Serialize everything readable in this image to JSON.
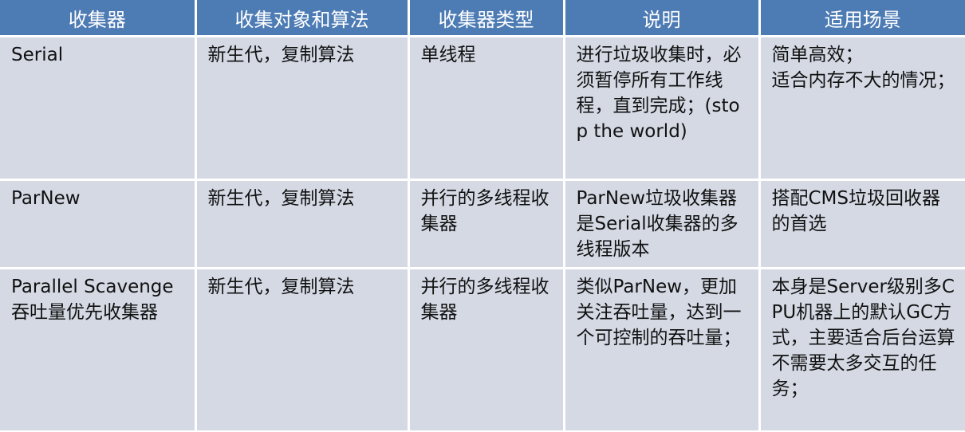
{
  "table": {
    "headers": [
      "收集器",
      "收集对象和算法",
      "收集器类型",
      "说明",
      "适用场景"
    ],
    "rows": [
      {
        "collector": "Serial",
        "target": "新生代，复制算法",
        "type": "单线程",
        "description": "进行垃圾收集时，必须暂停所有工作线程，直到完成；(stop the world)",
        "scenario": "简单高效；\n适合内存不大的情况；"
      },
      {
        "collector": "ParNew",
        "target": "新生代，复制算法",
        "type": "并行的多线程收集器",
        "description": "ParNew垃圾收集器是Serial收集器的多线程版本",
        "scenario": "搭配CMS垃圾回收器的首选"
      },
      {
        "collector": "Parallel Scavenge\n吞吐量优先收集器",
        "target": "新生代，复制算法",
        "type": "并行的多线程收集器",
        "description": "类似ParNew，更加关注吞吐量，达到一个可控制的吞吐量；",
        "scenario": "本身是Server级别多CPU机器上的默认GC方式，主要适合后台运算不需要太多交互的任务；"
      }
    ]
  },
  "colors": {
    "header_bg": "#4d7bb4",
    "header_text": "#ffffff",
    "cell_bg": "#d4d9e4",
    "cell_text": "#111111"
  }
}
